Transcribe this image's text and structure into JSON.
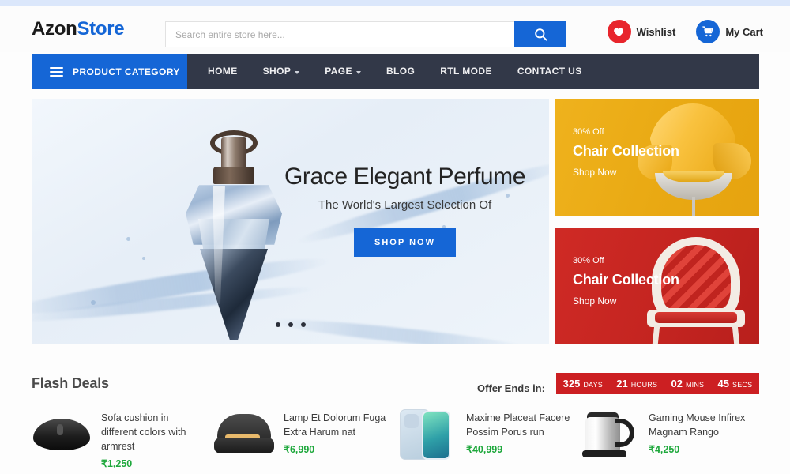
{
  "site": {
    "logo_primary": "Azon",
    "logo_secondary": "Store",
    "accent_blue": "#1566d6",
    "nav_bg": "#323848",
    "price_green": "#1ea83c",
    "countdown_red": "#cc1f22"
  },
  "search": {
    "placeholder": "Search entire store here...",
    "value": "",
    "icon": "search-icon"
  },
  "header": {
    "wishlist_label": "Wishlist",
    "wishlist_icon": "heart-icon",
    "cart_label": "My Cart",
    "cart_icon": "shopping-cart-icon"
  },
  "nav": {
    "category_button": "PRODUCT CATEGORY",
    "category_icon": "hamburger-icon",
    "links": [
      {
        "label": "HOME",
        "has_dropdown": false
      },
      {
        "label": "SHOP",
        "has_dropdown": true
      },
      {
        "label": "PAGE",
        "has_dropdown": true
      },
      {
        "label": "BLOG",
        "has_dropdown": false
      },
      {
        "label": "RTL MODE",
        "has_dropdown": false
      },
      {
        "label": "CONTACT US",
        "has_dropdown": false
      }
    ]
  },
  "hero": {
    "title": "Grace Elegant Perfume",
    "subtitle": "The World's Largest Selection Of",
    "button": "SHOP NOW",
    "slide_count": 3,
    "active_slide": 1
  },
  "promos": [
    {
      "off": "30% Off",
      "title": "Chair Collection",
      "shop": "Shop Now",
      "bg": "#e9a913"
    },
    {
      "off": "30% Off",
      "title": "Chair Collection",
      "shop": "Shop Now",
      "bg": "#c32420"
    }
  ],
  "flash": {
    "title": "Flash Deals",
    "offer_label": "Offer Ends in:",
    "countdown": [
      {
        "value": "325",
        "unit": "DAYS"
      },
      {
        "value": "21",
        "unit": "HOURS"
      },
      {
        "value": "02",
        "unit": "MINS"
      },
      {
        "value": "45",
        "unit": "SECS"
      }
    ],
    "products": [
      {
        "name": "Sofa cushion in different colors with armrest",
        "price": "₹1,250",
        "thumb": "computer-mouse"
      },
      {
        "name": "Lamp Et Dolorum Fuga Extra Harum nat",
        "price": "₹6,990",
        "thumb": "sandwich-maker"
      },
      {
        "name": "Maxime Placeat Facere Possim Porus run",
        "price": "₹40,999",
        "thumb": "smartphone"
      },
      {
        "name": "Gaming Mouse Infirex Magnam Rango",
        "price": "₹4,250",
        "thumb": "electric-kettle"
      }
    ]
  }
}
